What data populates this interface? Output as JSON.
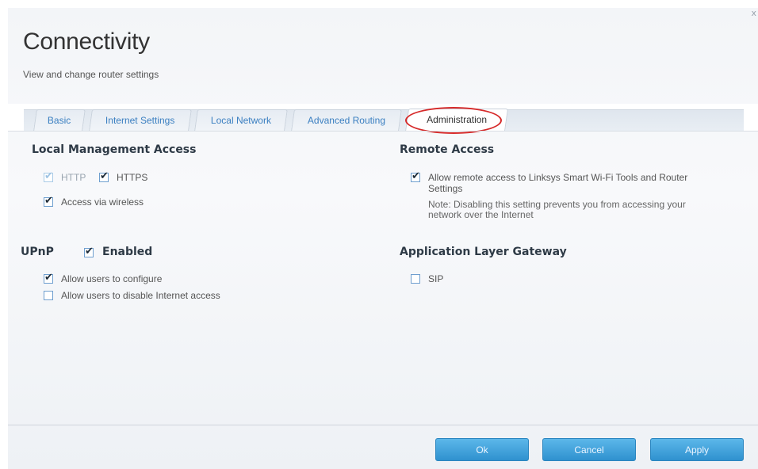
{
  "window": {
    "close_glyph": "x"
  },
  "header": {
    "title": "Connectivity",
    "subtitle": "View and change router settings"
  },
  "tabs": [
    {
      "label": "Basic"
    },
    {
      "label": "Internet Settings"
    },
    {
      "label": "Local Network"
    },
    {
      "label": "Advanced Routing"
    },
    {
      "label": "Administration",
      "active": true
    }
  ],
  "local_management": {
    "title": "Local Management Access",
    "http": {
      "label": "HTTP",
      "checked": true,
      "disabled": true
    },
    "https": {
      "label": "HTTPS",
      "checked": true
    },
    "wireless": {
      "label": "Access via wireless",
      "checked": true
    }
  },
  "remote_access": {
    "title": "Remote Access",
    "allow": {
      "label_line1": "Allow remote access to Linksys Smart Wi-Fi Tools and Router",
      "label_line2": "Settings",
      "checked": true
    },
    "note_line1": "Note: Disabling this setting prevents you from accessing your",
    "note_line2": "network over the Internet"
  },
  "upnp": {
    "title": "UPnP",
    "enabled_label": "Enabled",
    "enabled": true,
    "allow_configure": {
      "label": "Allow users to configure",
      "checked": true
    },
    "allow_disable": {
      "label": "Allow users to disable Internet access",
      "checked": false
    }
  },
  "alg": {
    "title": "Application Layer Gateway",
    "sip": {
      "label": "SIP",
      "checked": false
    }
  },
  "buttons": {
    "ok": "Ok",
    "cancel": "Cancel",
    "apply": "Apply"
  },
  "colors": {
    "accent_blue": "#3a7fc1",
    "button_blue": "#2f91cf",
    "highlight_red": "#d62a2a"
  }
}
